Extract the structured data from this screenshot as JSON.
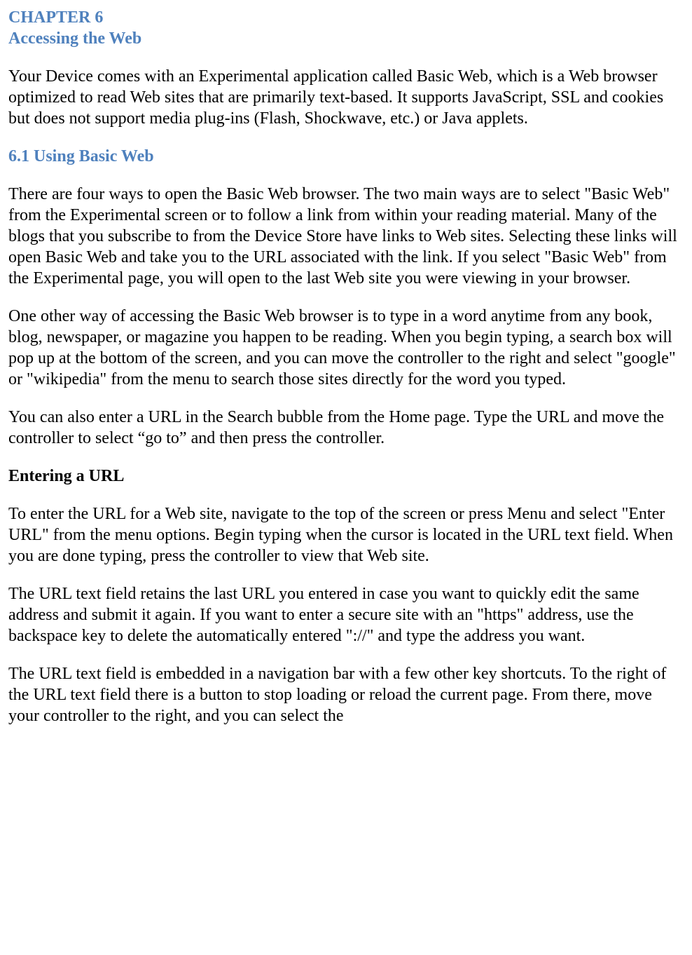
{
  "chapter": {
    "label": "CHAPTER 6",
    "title": "Accessing the Web"
  },
  "intro": "Your Device comes with an Experimental application called Basic Web, which is a Web browser optimized to read Web sites that are primarily text-based. It supports JavaScript, SSL and cookies but does not support media plug-ins (Flash, Shockwave, etc.) or Java applets.",
  "section1": {
    "heading": "6.1 Using Basic Web",
    "p1": "There are four ways to open the Basic Web browser. The two main ways are to select \"Basic Web\" from the Experimental screen or to follow a link from within your reading material. Many of the blogs that you subscribe to from the Device Store have links to Web sites. Selecting these links will open Basic Web and take you to the URL associated with the link. If you select \"Basic Web\" from the Experimental page, you will open to the last Web site you were viewing in your browser.",
    "p2": "One other way of accessing the Basic Web browser is to type in a word anytime from any book, blog, newspaper, or magazine you happen to be reading. When you begin typing, a search box will pop up at the bottom of the screen, and you can move the controller to the right and select \"google\" or \"wikipedia\" from the menu to search those sites directly for the word you typed.",
    "p3": "You can also enter a URL in the Search bubble from the Home page. Type the URL and move the controller to select “go to” and then press the controller."
  },
  "subsection1": {
    "heading": "Entering a URL",
    "p1": "To enter the URL for a Web site, navigate to the top of the screen or press Menu and select \"Enter URL\" from the menu options. Begin typing when the cursor is located in the URL text field. When you are done typing, press the controller to view that Web site.",
    "p2": "The URL text field retains the last URL you entered in case you want to quickly edit the same address and submit it again. If you want to enter a secure site with an \"https\" address, use the backspace key to delete the automatically entered \"://\" and type the address you want.",
    "p3": "The URL text field is embedded in a navigation bar with a few other key shortcuts. To the right of the URL text field there is a button to stop loading or reload the current page. From there, move your controller to the right, and you can select the"
  }
}
